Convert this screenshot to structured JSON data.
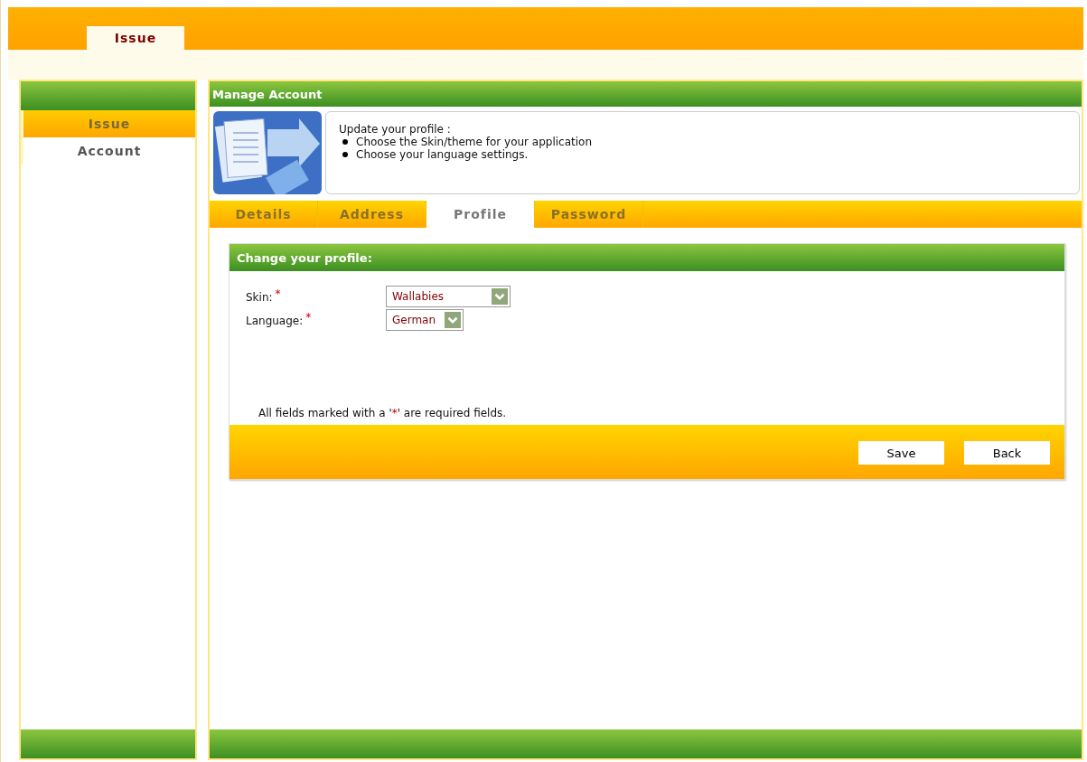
{
  "top_nav": {
    "tabs": [
      {
        "label": "Issue",
        "selected": true
      }
    ]
  },
  "sidebar": {
    "items": [
      {
        "label": "Issue",
        "selected": true
      },
      {
        "label": "Account",
        "selected": false
      }
    ]
  },
  "main": {
    "title": "Manage Account",
    "intro": {
      "heading": "Update your profile :",
      "bullets": [
        "Choose the Skin/theme for your application",
        "Choose your language settings."
      ]
    },
    "tabs": [
      {
        "label": "Details",
        "selected": false
      },
      {
        "label": "Address",
        "selected": false
      },
      {
        "label": "Profile",
        "selected": true
      },
      {
        "label": "Password",
        "selected": false
      }
    ],
    "form": {
      "title": "Change your profile:",
      "fields": [
        {
          "label": "Skin:",
          "required_mark": "*",
          "value": "Wallabies"
        },
        {
          "label": "Language:",
          "required_mark": "*",
          "value": "German"
        }
      ],
      "required_note": {
        "before": "All fields marked with a '",
        "mark": "*",
        "after": "' are required fields."
      },
      "buttons": [
        "Save",
        "Back"
      ]
    }
  }
}
